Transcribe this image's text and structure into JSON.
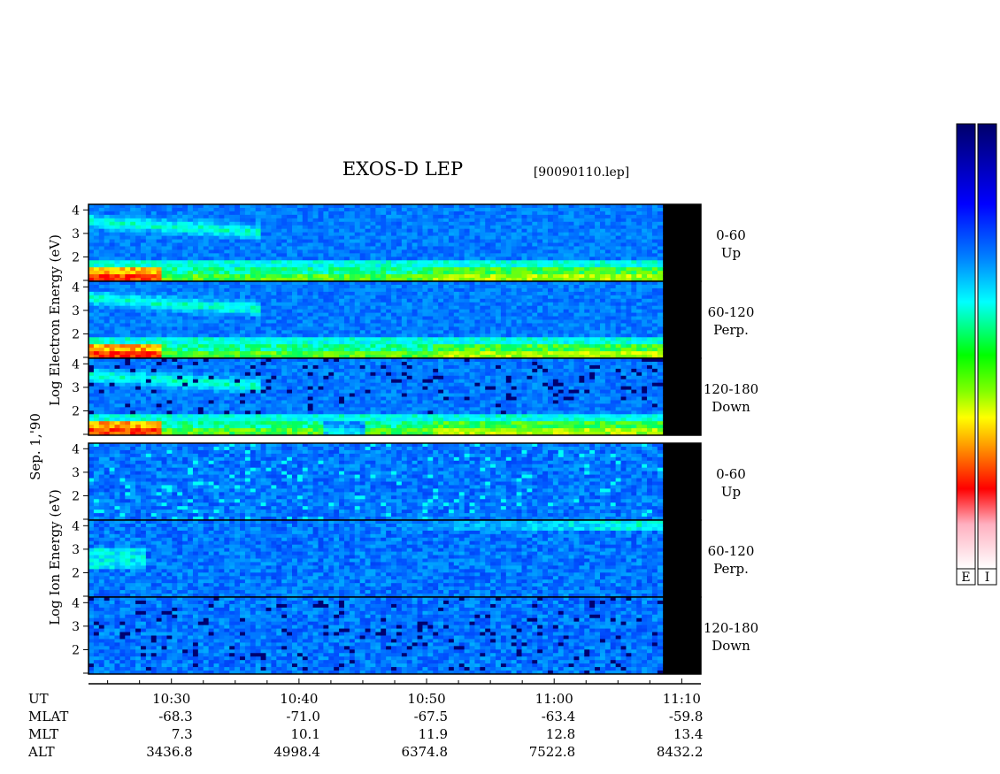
{
  "chart_data": {
    "type": "heatmap",
    "title": "EXOS-D LEP",
    "file_label": "[90090110.lep]",
    "date_label": "Sep. 1,'90",
    "electron_ylabel": "Log Electron Energy (eV)",
    "ion_ylabel": "Log Ion Energy (eV)",
    "y_ticks": [
      1,
      2,
      3,
      4
    ],
    "ylim": [
      1,
      4.2
    ],
    "x_axis": {
      "ut_label": "UT",
      "mlat_label": "MLAT",
      "mlt_label": "MLT",
      "alt_label": "ALT",
      "xlim_minutes": [
        -6.5,
        41.5
      ],
      "major_ticks": [
        {
          "minutes": 0,
          "ut": "10:30",
          "mlat": "-68.3",
          "mlt": "7.3",
          "alt": "3436.8"
        },
        {
          "minutes": 10,
          "ut": "10:40",
          "mlat": "-71.0",
          "mlt": "10.1",
          "alt": "4998.4"
        },
        {
          "minutes": 20,
          "ut": "10:50",
          "mlat": "-67.5",
          "mlt": "11.9",
          "alt": "6374.8"
        },
        {
          "minutes": 30,
          "ut": "11:00",
          "mlat": "-63.4",
          "mlt": "12.8",
          "alt": "7522.8"
        },
        {
          "minutes": 40,
          "ut": "11:10",
          "mlat": "-59.8",
          "mlt": "13.4",
          "alt": "8432.2"
        }
      ],
      "minor_step_minutes": 2.5,
      "data_end_minutes": 38.5
    },
    "panels": [
      {
        "group": "electron",
        "pitch": "0-60",
        "dir": "Up"
      },
      {
        "group": "electron",
        "pitch": "60-120",
        "dir": "Perp."
      },
      {
        "group": "electron",
        "pitch": "120-180",
        "dir": "Down"
      },
      {
        "group": "ion",
        "pitch": "0-60",
        "dir": "Up"
      },
      {
        "group": "ion",
        "pitch": "60-120",
        "dir": "Perp."
      },
      {
        "group": "ion",
        "pitch": "120-180",
        "dir": "Down"
      }
    ],
    "colorbar": {
      "labels": [
        "E",
        "I"
      ],
      "colors": [
        "#000080",
        "#0000ff",
        "#0080ff",
        "#00ffff",
        "#00ff00",
        "#ffff00",
        "#ff8000",
        "#ff0000",
        "#ffb0c0",
        "#ffffff"
      ]
    }
  }
}
